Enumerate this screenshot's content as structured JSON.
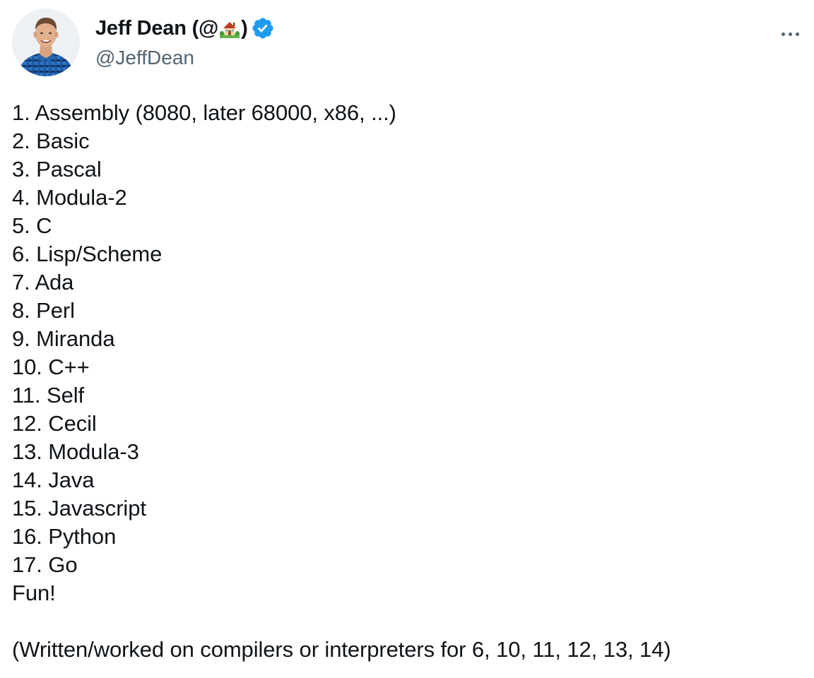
{
  "author": {
    "display_name_prefix": "Jeff Dean (@",
    "display_name_emoji": "house-with-garden-emoji",
    "display_name_suffix": ")",
    "verified": true,
    "handle": "@JeffDean",
    "avatar": "person-avatar",
    "verified_color": "#1d9bf0"
  },
  "menu": {
    "icon": "more-horizontal-icon"
  },
  "tweet": {
    "lines": [
      "1. Assembly (8080, later 68000, x86, ...)",
      "2. Basic",
      "3. Pascal",
      "4. Modula-2",
      "5. C",
      "6. Lisp/Scheme",
      "7. Ada",
      "8. Perl",
      "9. Miranda",
      "10. C++",
      "11. Self",
      "12. Cecil",
      "13. Modula-3",
      "14. Java",
      "15. Javascript",
      "16. Python",
      "17. Go",
      "Fun!"
    ],
    "footnote": "(Written/worked on compilers or interpreters for 6, 10, 11, 12, 13, 14)"
  },
  "colors": {
    "text": "#0f1419",
    "secondary_text": "#536471"
  }
}
